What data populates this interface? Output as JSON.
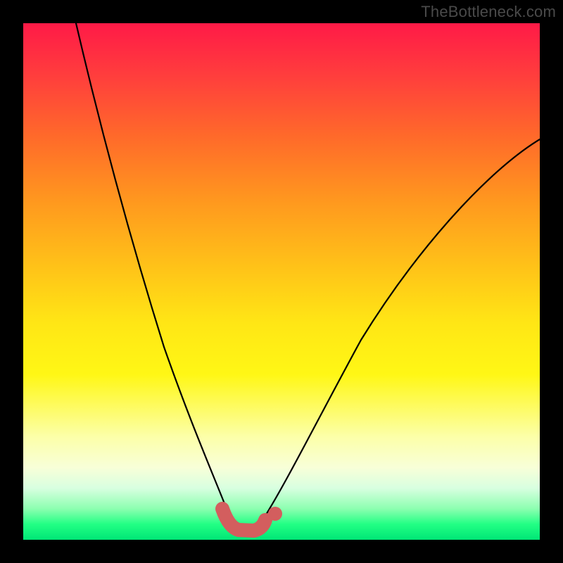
{
  "watermark": "TheBottleneck.com",
  "chart_data": {
    "type": "line",
    "title": "",
    "xlabel": "",
    "ylabel": "",
    "xlim": [
      0,
      100
    ],
    "ylim": [
      0,
      100
    ],
    "grid": false,
    "legend": false,
    "background_gradient": {
      "top": "#ff1a47",
      "mid": "#fff715",
      "bottom": "#00e676"
    },
    "series": [
      {
        "name": "left-branch",
        "color": "#000000",
        "x": [
          10,
          15,
          20,
          25,
          30,
          35,
          38,
          40
        ],
        "y": [
          100,
          80,
          59,
          40,
          24,
          11,
          5,
          3
        ]
      },
      {
        "name": "right-branch",
        "color": "#000000",
        "x": [
          46,
          50,
          55,
          62,
          70,
          80,
          90,
          100
        ],
        "y": [
          3,
          7,
          15,
          26,
          39,
          53,
          66,
          78
        ]
      },
      {
        "name": "valley-floor",
        "color": "#d35e5e",
        "style": "thick",
        "x": [
          38,
          40,
          42,
          44,
          46
        ],
        "y": [
          5,
          2.5,
          2,
          2.5,
          3.5
        ]
      }
    ],
    "markers": [
      {
        "name": "valley-end-dot",
        "x": 48.5,
        "y": 5,
        "color": "#d35e5e"
      }
    ],
    "notes": "y-values are approximate readings from an unlabeled plot; 100 corresponds to the top of the plot area and 0 to the bottom."
  }
}
